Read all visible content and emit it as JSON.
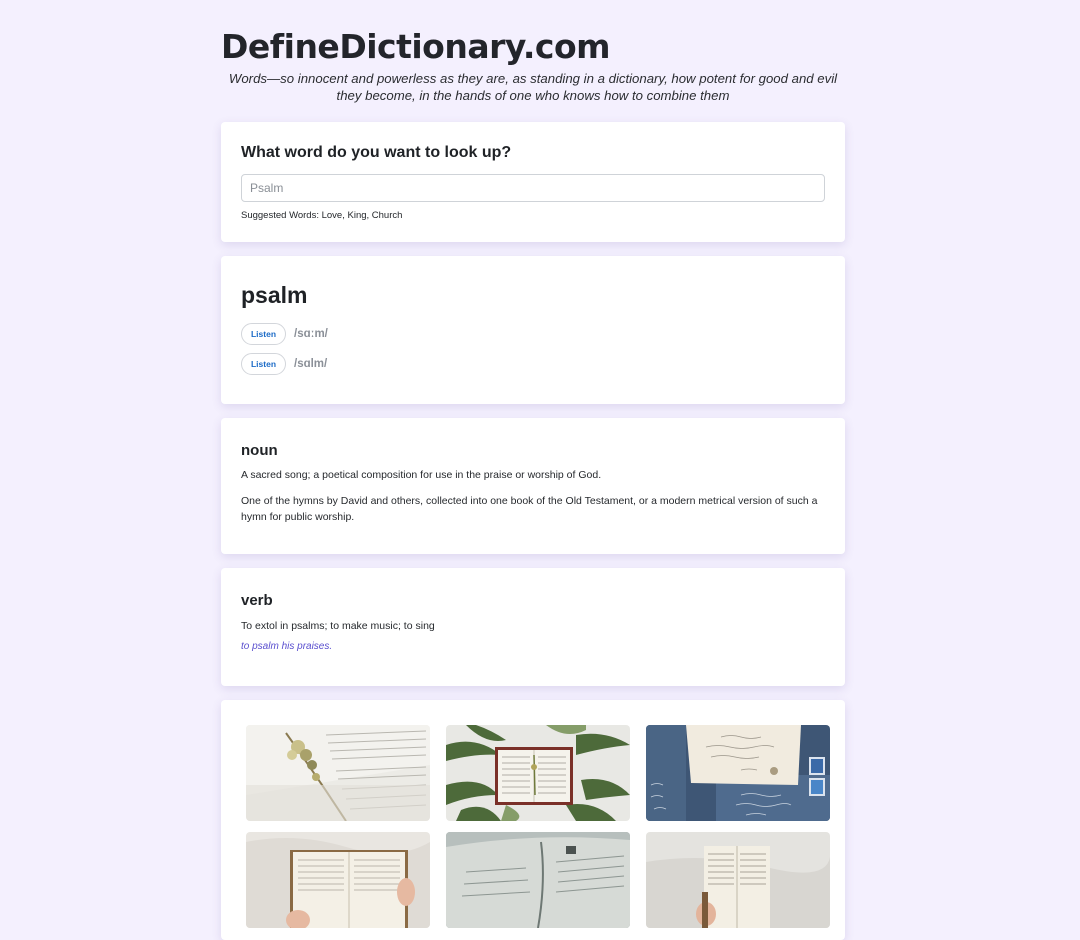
{
  "site": {
    "title": "DefineDictionary.com",
    "tagline": "Words—so innocent and powerless as they are, as standing in a dictionary, how potent for good and evil they become, in the hands of one who knows how to combine them"
  },
  "search": {
    "heading": "What word do you want to look up?",
    "placeholder": "Psalm",
    "suggestions": "Suggested Words: Love, King, Church"
  },
  "entry": {
    "word": "psalm",
    "pronunciations": [
      {
        "button_label": "Listen",
        "phonetic": "/sɑːm/"
      },
      {
        "button_label": "Listen",
        "phonetic": "/sɑlm/"
      }
    ]
  },
  "meanings": {
    "noun": {
      "part_of_speech": "noun",
      "definitions": [
        "A sacred song; a poetical composition for use in the praise or worship of God.",
        "One of the hymns by David and others, collected into one book of the Old Testament, or a modern metrical version of such a hymn for public worship."
      ]
    },
    "verb": {
      "part_of_speech": "verb",
      "definitions": [
        "To extol in psalms; to make music; to sing"
      ],
      "example": "to psalm his praises."
    }
  },
  "gallery": {
    "images": [
      "open-book-with-dried-flowers",
      "bible-on-fern-leaves",
      "handwritten-letters-blue",
      "hands-holding-open-bible",
      "open-book-closeup",
      "hand-holding-worn-bible"
    ]
  },
  "colors": {
    "background": "#f4f0fe",
    "card": "#ffffff",
    "link_blue": "#1c6bc7",
    "example_purple": "#5a4fcf"
  }
}
